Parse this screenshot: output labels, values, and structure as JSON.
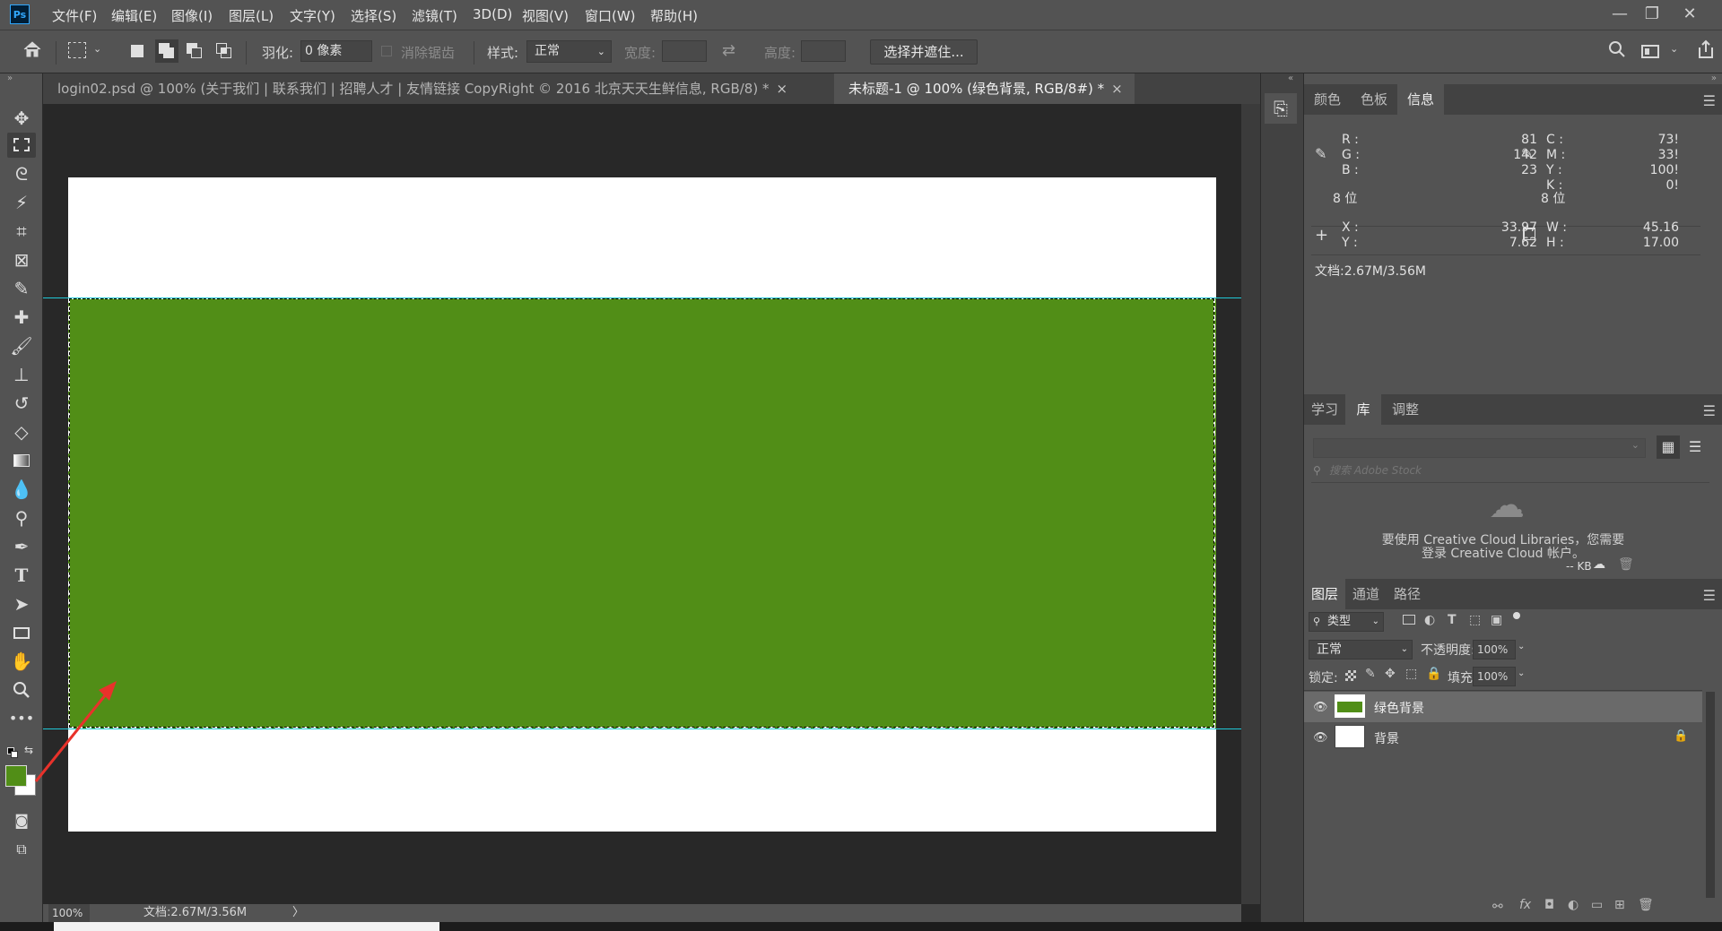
{
  "app": {
    "logo": "Ps"
  },
  "menu": [
    "文件(F)",
    "编辑(E)",
    "图像(I)",
    "图层(L)",
    "文字(Y)",
    "选择(S)",
    "滤镜(T)",
    "3D(D)",
    "视图(V)",
    "窗口(W)",
    "帮助(H)"
  ],
  "window_buttons": {
    "minimize": "—",
    "restore": "❐",
    "close": "✕"
  },
  "options": {
    "feather_label": "羽化:",
    "feather_value": "0 像素",
    "antialias_label": "消除锯齿",
    "style_label": "样式:",
    "style_value": "正常",
    "width_label": "宽度:",
    "height_label": "高度:",
    "select_mask_button": "选择并遮住..."
  },
  "doc_tabs": [
    {
      "label": "login02.psd @ 100% (关于我们   |   联系我们   |   招聘人才   |   友情链接 CopyRight © 2016 北京天天生鲜信息, RGB/8) *"
    },
    {
      "label": "未标题-1 @ 100% (绿色背景, RGB/8#) *"
    }
  ],
  "tab_close": "×",
  "colors": {
    "foreground": "#518e17",
    "background": "#ffffff",
    "accent": "#20c7d6"
  },
  "status": {
    "zoom": "100%",
    "doc": "文档:2.67M/3.56M",
    "arrow": "〉"
  },
  "info_panel": {
    "tabs": [
      "颜色",
      "色板",
      "信息"
    ],
    "rgb_labels": [
      "R :",
      "G :",
      "B :"
    ],
    "rgb_values": [
      "81",
      "142",
      "23"
    ],
    "cmyk_labels": [
      "C :",
      "M :",
      "Y :",
      "K :"
    ],
    "cmyk_values": [
      "73!",
      "33!",
      "100!",
      "0!"
    ],
    "bit_left": "8 位",
    "bit_right": "8 位",
    "xy_labels": [
      "X :",
      "Y :"
    ],
    "xy_values": [
      "33.97",
      "7.62"
    ],
    "wh_labels": [
      "W :",
      "H :"
    ],
    "wh_values": [
      "45.16",
      "17.00"
    ],
    "doc": "文档:2.67M/3.56M"
  },
  "library_panel": {
    "tabs": [
      "学习",
      "库",
      "调整"
    ],
    "search_placeholder": "搜索 Adobe Stock",
    "message_line1": "要使用 Creative Cloud Libraries，您需要",
    "message_line2": "登录 Creative Cloud 帐户。",
    "footer": "-- KB"
  },
  "layers_panel": {
    "tabs": [
      "图层",
      "通道",
      "路径"
    ],
    "filter_label": "类型",
    "blend_mode": "正常",
    "opacity_label": "不透明度:",
    "opacity_value": "100%",
    "lock_label": "锁定:",
    "fill_label": "填充:",
    "fill_value": "100%",
    "layers": [
      {
        "name": "绿色背景",
        "color": "#518e17"
      },
      {
        "name": "背景",
        "color": "#ffffff"
      }
    ]
  }
}
